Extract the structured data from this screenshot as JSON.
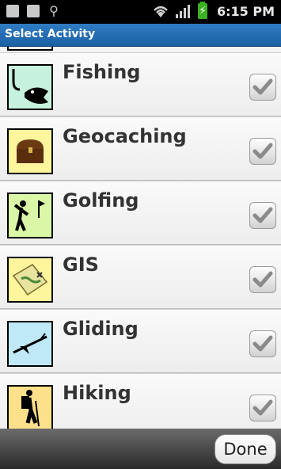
{
  "status_bar": {
    "time": "6:15 PM",
    "icons": [
      "download-icon",
      "download-icon",
      "usb-icon",
      "wifi-icon",
      "signal-icon",
      "battery-charging-icon"
    ]
  },
  "title": "Select Activity",
  "activities": [
    {
      "label": "Fishing",
      "icon": "fishing-icon",
      "checked": true,
      "thumb_bg": "#c6f1dc"
    },
    {
      "label": "Geocaching",
      "icon": "treasure-chest-icon",
      "checked": true,
      "thumb_bg": "#fdf69c"
    },
    {
      "label": "Golfing",
      "icon": "golfer-icon",
      "checked": true,
      "thumb_bg": "#d9f7a6"
    },
    {
      "label": "GIS",
      "icon": "map-icon",
      "checked": true,
      "thumb_bg": "#fdf69c"
    },
    {
      "label": "Gliding",
      "icon": "glider-icon",
      "checked": true,
      "thumb_bg": "#bfe9f6"
    },
    {
      "label": "Hiking",
      "icon": "hiker-icon",
      "checked": true,
      "thumb_bg": "#fde08a"
    }
  ],
  "done_label": "Done",
  "colors": {
    "title_bar": "#1b5fa3",
    "check_mark": "#8a8a8a"
  }
}
